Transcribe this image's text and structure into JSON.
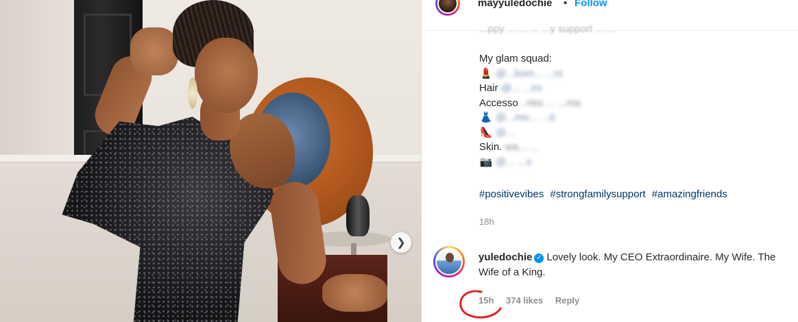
{
  "post": {
    "username": "mayyuledochie",
    "separator": "•",
    "follow_label": "Follow",
    "caption": {
      "first_line_fragment": "...ppy ... ... ... ...y support ... ...",
      "glam_heading": "My glam squad:",
      "lines": [
        {
          "emoji": "💄",
          "label": "",
          "blurred": "@...kom... ...rs"
        },
        {
          "emoji": "",
          "label": "Hair",
          "blurred": "@... ...irs"
        },
        {
          "emoji": "",
          "label": "Accesso",
          "blurred": "...ries ... ...ma"
        },
        {
          "emoji": "👗",
          "label": "",
          "blurred": "@...mo... ...d"
        },
        {
          "emoji": "👠",
          "label": "",
          "blurred": "@..."
        },
        {
          "emoji": "",
          "label": "Skin.",
          "blurred": "wa... ..."
        },
        {
          "emoji": "📷",
          "label": "",
          "blurred": "@... ...s"
        }
      ]
    },
    "hashtags": [
      "#positivevibes",
      "#strongfamilysupport",
      "#amazingfriends"
    ],
    "time": "18h",
    "carousel_next_icon": "chevron-right-icon"
  },
  "comment": {
    "username": "yuledochie",
    "verified_icon": "verified-badge-icon",
    "text": "Lovely look. My CEO Extraordinaire. My Wife. The Wife of a King.",
    "time": "15h",
    "likes": "374 likes",
    "reply_label": "Reply"
  },
  "colors": {
    "link": "#0095f6",
    "mention": "#00376b",
    "meta": "#8e8e8e",
    "annotation": "#e0201b"
  }
}
